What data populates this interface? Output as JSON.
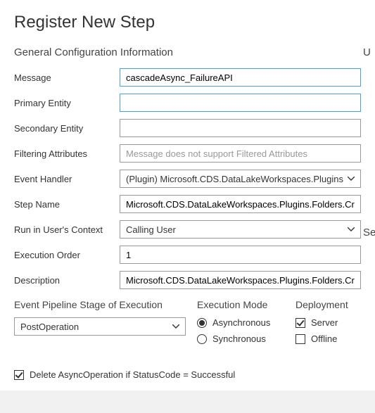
{
  "header": {
    "title": "Register New Step"
  },
  "general": {
    "title": "General Configuration Information",
    "labels": {
      "message": "Message",
      "primaryEntity": "Primary Entity",
      "secondaryEntity": "Secondary Entity",
      "filteringAttributes": "Filtering Attributes",
      "eventHandler": "Event Handler",
      "stepName": "Step Name",
      "runInUser": "Run in User's Context",
      "executionOrder": "Execution Order",
      "description": "Description"
    },
    "values": {
      "message": "cascadeAsync_FailureAPI",
      "primaryEntity": "",
      "secondaryEntity": "",
      "filteringAttributesPlaceholder": "Message does not support Filtered Attributes",
      "eventHandler": "(Plugin) Microsoft.CDS.DataLakeWorkspaces.Plugins.Folders.C",
      "stepName": "Microsoft.CDS.DataLakeWorkspaces.Plugins.Folders.CreateFolderA",
      "runInUser": "Calling User",
      "executionOrder": "1",
      "description": "Microsoft.CDS.DataLakeWorkspaces.Plugins.Folders.CreateFolderA"
    }
  },
  "pipeline": {
    "title": "Event Pipeline Stage of Execution",
    "selected": "PostOperation"
  },
  "executionMode": {
    "title": "Execution Mode",
    "options": {
      "async": {
        "label": "Asynchronous",
        "checked": true
      },
      "sync": {
        "label": "Synchronous",
        "checked": false
      }
    }
  },
  "deployment": {
    "title": "Deployment",
    "options": {
      "server": {
        "label": "Server",
        "checked": true
      },
      "offline": {
        "label": "Offline",
        "checked": false
      }
    }
  },
  "deleteAsync": {
    "label": "Delete AsyncOperation if StatusCode = Successful",
    "checked": true
  },
  "rightEdge": {
    "top": "U",
    "mid": "Se"
  }
}
